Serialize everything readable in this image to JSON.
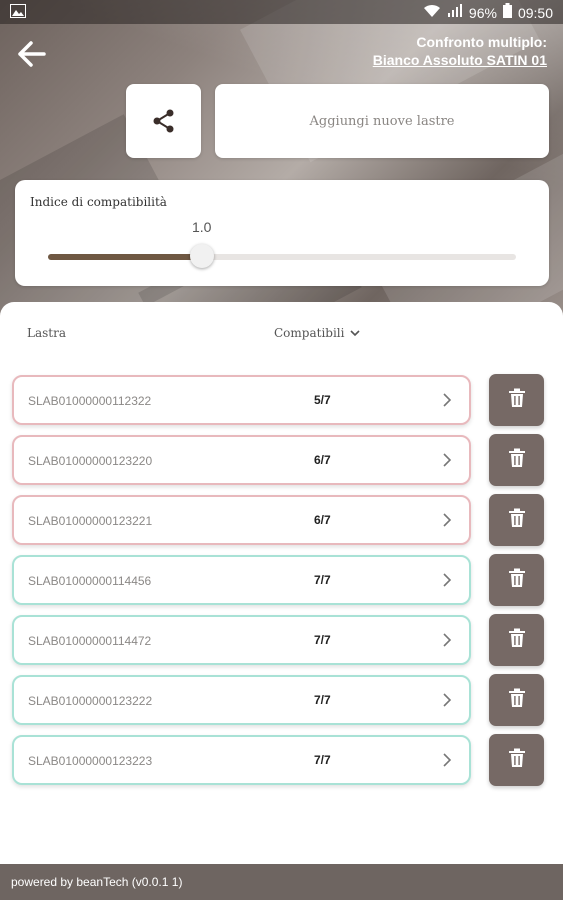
{
  "status_bar": {
    "battery": "96%",
    "time": "09:50"
  },
  "header": {
    "title": "Confronto multiplo:",
    "subtitle": "Bianco Assoluto SATIN 01"
  },
  "actions": {
    "add_label": "Aggiungi nuove lastre"
  },
  "compatibility": {
    "label": "Indice di compatibilità",
    "value": "1.0",
    "slider_fraction": 0.33
  },
  "list": {
    "col_lastra": "Lastra",
    "col_compatibili": "Compatibili",
    "rows": [
      {
        "code": "SLAB01000000112322",
        "count": "5/7"
      },
      {
        "code": "SLAB01000000123220",
        "count": "6/7"
      },
      {
        "code": "SLAB01000000123221",
        "count": "6/7"
      },
      {
        "code": "SLAB01000000114456",
        "count": "7/7"
      },
      {
        "code": "SLAB01000000114472",
        "count": "7/7"
      },
      {
        "code": "SLAB01000000123222",
        "count": "7/7"
      },
      {
        "code": "SLAB01000000123223",
        "count": "7/7"
      }
    ]
  },
  "footer": {
    "text": "powered by beanTech  (v0.0.1 1)"
  },
  "colors": {
    "accent_brown": "#6f5843",
    "delete_button": "#766965",
    "border_partial": "#e8b9bd",
    "border_full": "#a9e2d6"
  }
}
